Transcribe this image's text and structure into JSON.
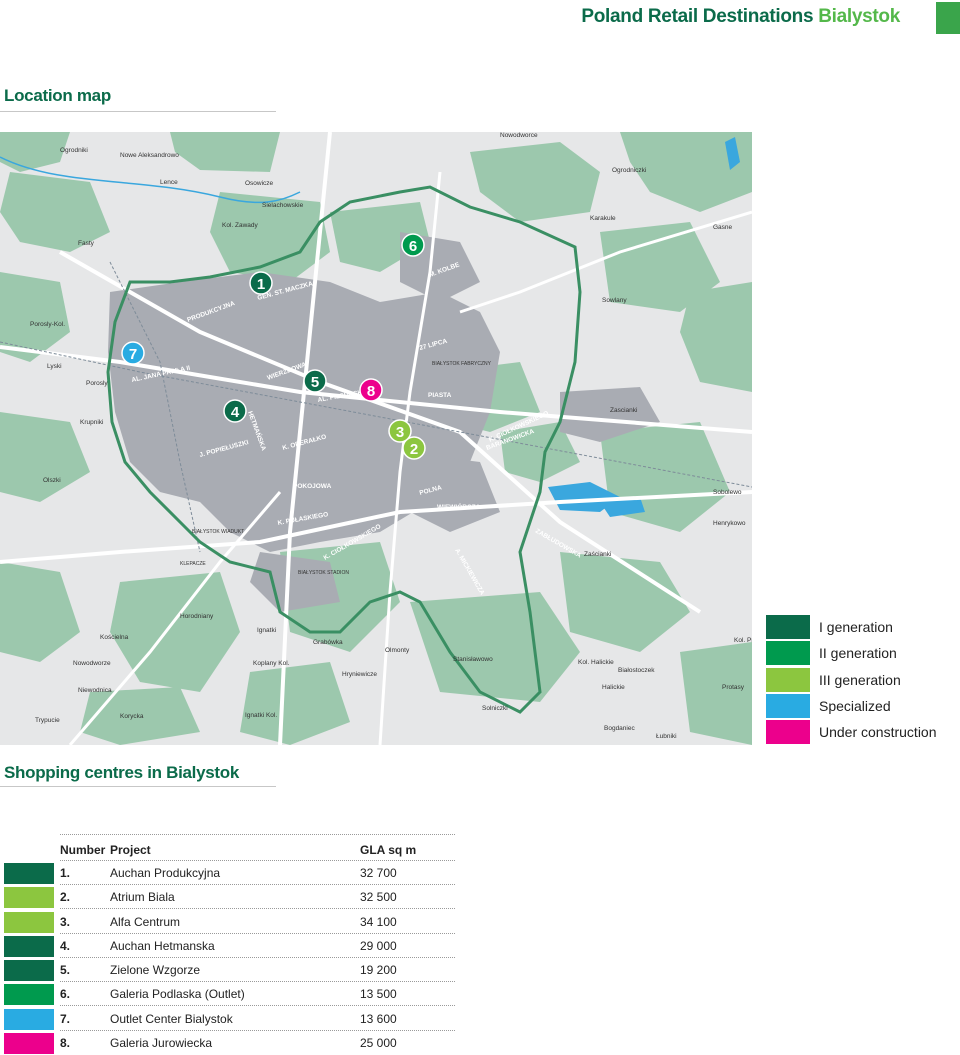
{
  "header": {
    "title_prefix": "Poland Retail Destinations",
    "title_city": "Bialystok"
  },
  "sections": {
    "location_map": "Location map",
    "shopping_centres": "Shopping centres in Bialystok"
  },
  "colors": {
    "brand_dark": "#0b6b4a",
    "brand_light": "#54b84a",
    "map_bg": "#e6e7e8",
    "map_green": "#9cc8ad",
    "city_blocks": "#a9acb3",
    "boundary": "#3a8f63",
    "water": "#3aa7de"
  },
  "map": {
    "markers": [
      {
        "label": "1",
        "color": "#0b6b4a"
      },
      {
        "label": "2",
        "color": "#8cc63f"
      },
      {
        "label": "3",
        "color": "#8cc63f"
      },
      {
        "label": "4",
        "color": "#0b6b4a"
      },
      {
        "label": "5",
        "color": "#0b6b4a"
      },
      {
        "label": "6",
        "color": "#009a4e"
      },
      {
        "label": "7",
        "color": "#29abe2"
      },
      {
        "label": "8",
        "color": "#ec008c"
      }
    ],
    "place_labels": [
      "Nowodworce",
      "Ogrodniki",
      "Nowe Aleksandrowo",
      "Lence",
      "Osowicze",
      "Ogrodniczki",
      "Sielachowskie",
      "Kol. Zawady",
      "Karakule",
      "Gasne",
      "Fasty",
      "Sowlany",
      "Porosly-Kol.",
      "Lyski",
      "Porosly",
      "Krupniki",
      "Zascianki",
      "Olszki",
      "Sobolewo",
      "Henrykowo",
      "Zaścianki",
      "Horodniany",
      "Kościelna",
      "Ignatki",
      "Grabówka",
      "Olmonty",
      "Stanisławowo",
      "Hryniewicze",
      "Nowodworze",
      "Niewodnica",
      "Korycka",
      "Ignatki Kol.",
      "Solniczki",
      "Kol. Halickie",
      "Białostoczek",
      "Halickie",
      "Kol. Protasy",
      "Protasy",
      "Bogdaniec",
      "Łubniki",
      "Trypucie",
      "Koplany Kol.",
      "GEN. ST. MACZKA",
      "M. KOLBE",
      "27 LIPCA",
      "PIASTA",
      "AL. JANA PAWŁA II",
      "AL. PIŁSUDSKIEGO",
      "K. CIOŁKOWSKIEGO",
      "K. PUŁASKIEGO",
      "POLNA",
      "WIEWIÓRCZA",
      "BARANOWICKA",
      "ZABŁUDOWSKA",
      "A. MICKIEWICZA",
      "WIERZBOWA",
      "PRODUKCYJNA",
      "HETMAŃSKA",
      "J. POPIEŁUSZKI",
      "K. OPERAŁKO",
      "POKOJOWA",
      "BIAŁYSTOK STADION",
      "BIAŁYSTOK FABRYCZNY",
      "BIAŁYSTOK WIADUKT",
      "KLEPACZE"
    ]
  },
  "legend": [
    {
      "label": "I generation",
      "color": "#0b6b4a"
    },
    {
      "label": "II generation",
      "color": "#009a4e"
    },
    {
      "label": "III generation",
      "color": "#8cc63f"
    },
    {
      "label": "Specialized",
      "color": "#29abe2"
    },
    {
      "label": "Under construction",
      "color": "#ec008c"
    }
  ],
  "table": {
    "headers": {
      "number": "Number",
      "project": "Project",
      "gla": "GLA sq m"
    },
    "rows": [
      {
        "number": "1.",
        "project": "Auchan Produkcyjna",
        "gla": "32 700",
        "color": "#0b6b4a"
      },
      {
        "number": "2.",
        "project": "Atrium Biala",
        "gla": "32 500",
        "color": "#8cc63f"
      },
      {
        "number": "3.",
        "project": "Alfa Centrum",
        "gla": "34 100",
        "color": "#8cc63f"
      },
      {
        "number": "4.",
        "project": "Auchan Hetmanska",
        "gla": "29 000",
        "color": "#0b6b4a"
      },
      {
        "number": "5.",
        "project": "Zielone Wzgorze",
        "gla": "19 200",
        "color": "#0b6b4a"
      },
      {
        "number": "6.",
        "project": "Galeria Podlaska (Outlet)",
        "gla": "13 500",
        "color": "#009a4e"
      },
      {
        "number": "7.",
        "project": "Outlet Center Bialystok",
        "gla": "13 600",
        "color": "#29abe2"
      },
      {
        "number": "8.",
        "project": "Galeria Jurowiecka",
        "gla": "25 000",
        "color": "#ec008c"
      }
    ]
  }
}
